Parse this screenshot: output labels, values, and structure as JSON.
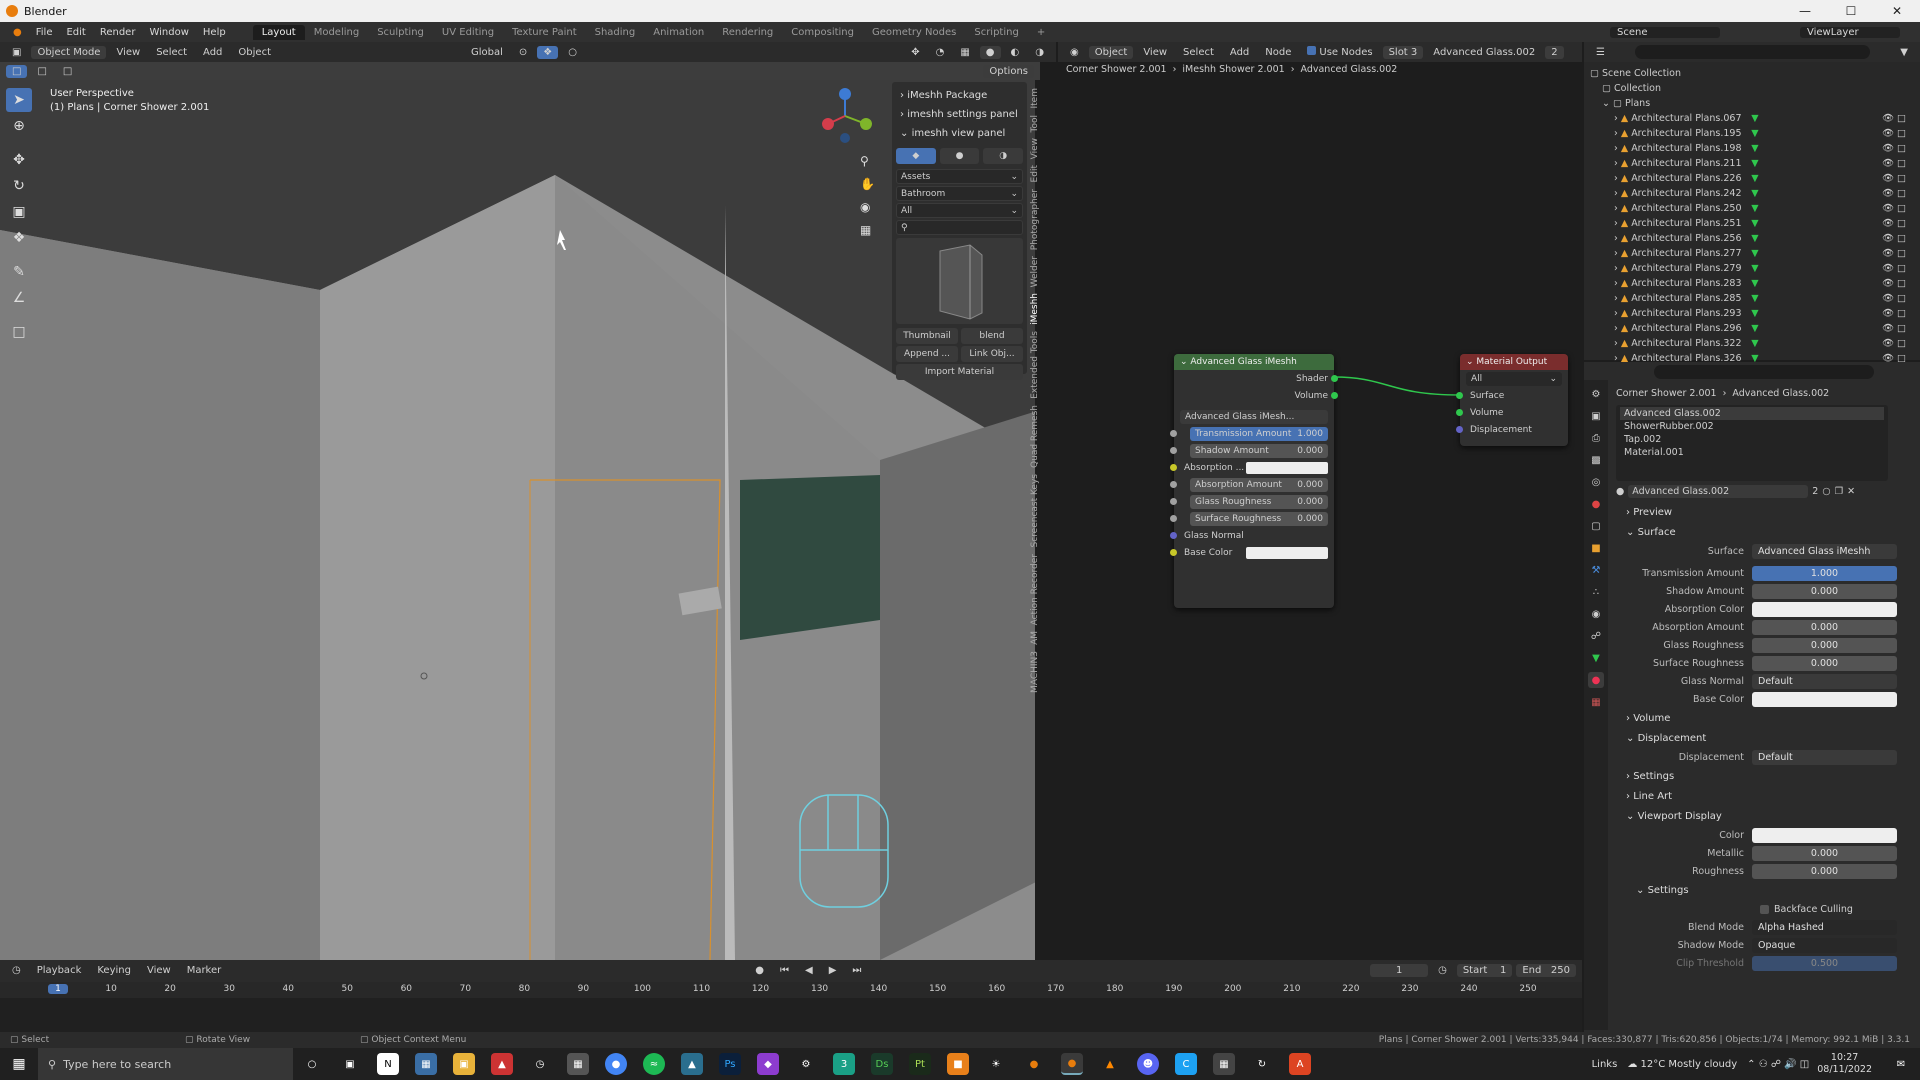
{
  "window": {
    "title": "Blender"
  },
  "menu": [
    "File",
    "Edit",
    "Render",
    "Window",
    "Help"
  ],
  "workspaces": [
    "Layout",
    "Modeling",
    "Sculpting",
    "UV Editing",
    "Texture Paint",
    "Shading",
    "Animation",
    "Rendering",
    "Compositing",
    "Geometry Nodes",
    "Scripting"
  ],
  "topright": {
    "scene": "Scene",
    "viewlayer": "ViewLayer"
  },
  "viewport_header": {
    "mode": "Object Mode",
    "view": "View",
    "select": "Select",
    "add": "Add",
    "object": "Object",
    "orientation": "Global",
    "options": "Options"
  },
  "viewport": {
    "perspective": "User Perspective",
    "collection_line": "(1) Plans | Corner Shower 2.001"
  },
  "npanel": {
    "items": [
      "iMeshh Package",
      "imeshh settings panel",
      "imeshh view panel"
    ],
    "assets": "Assets",
    "category": "Bathroom",
    "filter": "All",
    "thumbnail": "Thumbnail",
    "blend": "blend",
    "append": "Append ...",
    "link": "Link Obj...",
    "import": "Import Material"
  },
  "ntabs": [
    "Item",
    "Tool",
    "View",
    "Edit",
    "Photographer",
    "Welder",
    "iMeshh",
    "Extended Tools",
    "Quad Remesh",
    "Screencast Keys",
    "Action Recorder",
    "AM",
    "MACHIN3"
  ],
  "node_header": {
    "object": "Object",
    "view": "View",
    "select": "Select",
    "add": "Add",
    "node": "Node",
    "use_nodes": "Use Nodes",
    "slot": "Slot 3",
    "material": "Advanced Glass.002",
    "users": "2"
  },
  "breadcrumb": [
    "Corner Shower 2.001",
    "iMeshh Shower 2.001",
    "Advanced Glass.002"
  ],
  "group_node": {
    "title": "Advanced Glass iMeshh",
    "outputs": [
      "Shader",
      "Volume"
    ],
    "group_name": "Advanced Glass iMesh...",
    "fields": [
      {
        "label": "Transmission Amount",
        "value": "1.000"
      },
      {
        "label": "Shadow Amount",
        "value": "0.000"
      },
      {
        "label": "Absorption ...",
        "value": ""
      },
      {
        "label": "Absorption Amount",
        "value": "0.000"
      },
      {
        "label": "Glass Roughness",
        "value": "0.000"
      },
      {
        "label": "Surface Roughness",
        "value": "0.000"
      },
      {
        "label": "Glass Normal",
        "value": ""
      },
      {
        "label": "Base Color",
        "value": ""
      }
    ]
  },
  "output_node": {
    "title": "Material Output",
    "target": "All",
    "inputs": [
      "Surface",
      "Volume",
      "Displacement"
    ]
  },
  "outliner": {
    "scene_collection": "Scene Collection",
    "collection": "Collection",
    "plans": "Plans",
    "items": [
      "Architectural Plans.067",
      "Architectural Plans.195",
      "Architectural Plans.198",
      "Architectural Plans.211",
      "Architectural Plans.226",
      "Architectural Plans.242",
      "Architectural Plans.250",
      "Architectural Plans.251",
      "Architectural Plans.256",
      "Architectural Plans.277",
      "Architectural Plans.279",
      "Architectural Plans.283",
      "Architectural Plans.285",
      "Architectural Plans.293",
      "Architectural Plans.296",
      "Architectural Plans.322",
      "Architectural Plans.326"
    ]
  },
  "props": {
    "breadcrumb_obj": "Corner Shower 2.001",
    "breadcrumb_mat": "Advanced Glass.002",
    "slots": [
      "Advanced Glass.002",
      "ShowerRubber.002",
      "Tap.002",
      "Material.001"
    ],
    "material": "Advanced Glass.002",
    "users": "2",
    "sections": {
      "preview": "Preview",
      "surface": "Surface",
      "volume": "Volume",
      "displacement": "Displacement",
      "settings": "Settings",
      "lineart": "Line Art",
      "viewport_display": "Viewport Display",
      "settings2": "Settings"
    },
    "surface_label": "Surface",
    "surface_value": "Advanced Glass iMeshh",
    "surface_fields": [
      {
        "label": "Transmission Amount",
        "value": "1.000"
      },
      {
        "label": "Shadow Amount",
        "value": "0.000"
      },
      {
        "label": "Absorption Color",
        "value": ""
      },
      {
        "label": "Absorption Amount",
        "value": "0.000"
      },
      {
        "label": "Glass Roughness",
        "value": "0.000"
      },
      {
        "label": "Surface Roughness",
        "value": "0.000"
      },
      {
        "label": "Glass Normal",
        "value": "Default"
      },
      {
        "label": "Base Color",
        "value": ""
      }
    ],
    "displacement_label": "Displacement",
    "displacement_value": "Default",
    "vd": [
      {
        "label": "Color",
        "value": ""
      },
      {
        "label": "Metallic",
        "value": "0.000"
      },
      {
        "label": "Roughness",
        "value": "0.000"
      }
    ],
    "backface": "Backface Culling",
    "blend_label": "Blend Mode",
    "blend_value": "Alpha Hashed",
    "shadow_label": "Shadow Mode",
    "shadow_value": "Opaque",
    "clip_label": "Clip Threshold",
    "clip_value": "0.500"
  },
  "timeline": {
    "menus": [
      "Playback",
      "Keying",
      "View",
      "Marker"
    ],
    "frame": "1",
    "start_label": "Start",
    "start": "1",
    "end_label": "End",
    "end": "250",
    "ticks": [
      "1",
      "10",
      "20",
      "30",
      "40",
      "50",
      "60",
      "70",
      "80",
      "90",
      "100",
      "110",
      "120",
      "130",
      "140",
      "150",
      "160",
      "170",
      "180",
      "190",
      "200",
      "210",
      "220",
      "230",
      "240",
      "250"
    ]
  },
  "status": {
    "select": "Select",
    "rotate": "Rotate View",
    "context": "Object Context Menu",
    "info": "Plans | Corner Shower 2.001 | Verts:335,944 | Faces:330,877 | Tris:620,856 | Objects:1/74 | Memory: 992.1 MiB | 3.3.1"
  },
  "taskbar": {
    "search": "Type here to search",
    "links": "Links",
    "weather": "12°C  Mostly cloudy",
    "time": "10:27",
    "date": "08/11/2022"
  },
  "colors": {
    "accent": "#4772b3",
    "node_group": "#3d6b3d",
    "node_output": "#7a2d2d",
    "socket_green": "#2fc74d",
    "socket_yellow": "#c7c729",
    "socket_grey": "#a1a1a1",
    "socket_purple": "#6363c7"
  }
}
